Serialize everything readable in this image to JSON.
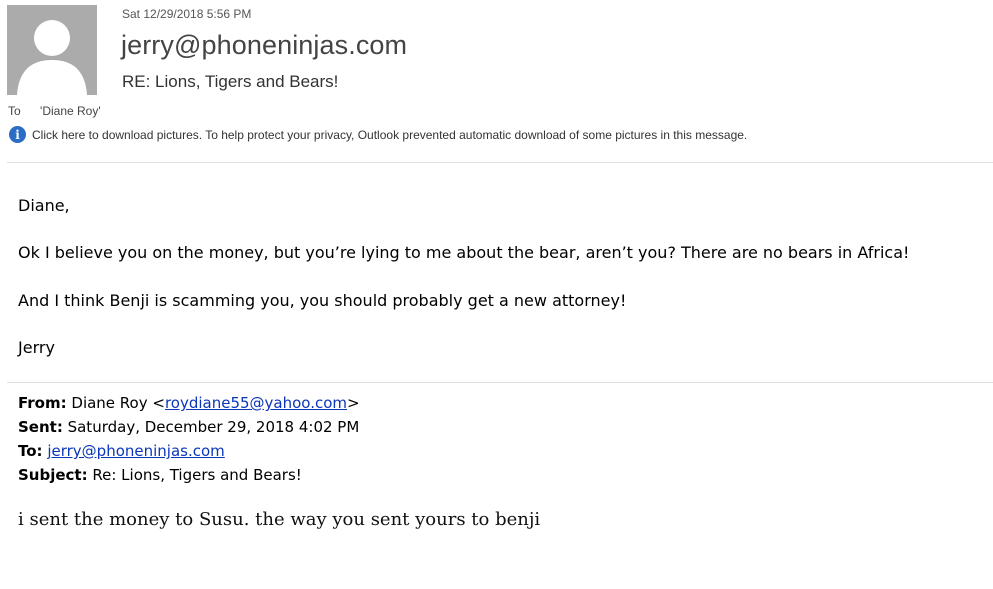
{
  "header": {
    "date": "Sat 12/29/2018 5:56 PM",
    "from": "jerry@phoneninjas.com",
    "subject": "RE: Lions, Tigers and Bears!",
    "to_label": "To",
    "to_value": "'Diane Roy'",
    "info_message": "Click here to download pictures. To help protect your privacy, Outlook prevented automatic download of some pictures in this message."
  },
  "body": {
    "greeting": "Diane,",
    "para1": "Ok I believe you on the money, but you’re lying to me about the bear, aren’t you?  There are no bears in Africa!",
    "para2": "And I think Benji is scamming you, you should probably get a new attorney!",
    "signature": "Jerry"
  },
  "quoted": {
    "from_label": "From:",
    "from_name": " Diane Roy <",
    "from_email": "roydiane55@yahoo.com",
    "from_close": ">",
    "sent_label": "Sent:",
    "sent_value": " Saturday, December 29, 2018 4:02 PM",
    "to_label": "To:",
    "to_email": "jerry@phoneninjas.com",
    "subject_label": "Subject:",
    "subject_value": " Re: Lions, Tigers and Bears!",
    "message": "i sent the money to Susu. the way you sent yours to benji"
  },
  "colors": {
    "link": "#0b36b8",
    "info_icon": "#2b6cc4",
    "avatar_bg": "#ababab"
  },
  "icons": [
    "avatar-placeholder-icon",
    "info-icon"
  ]
}
